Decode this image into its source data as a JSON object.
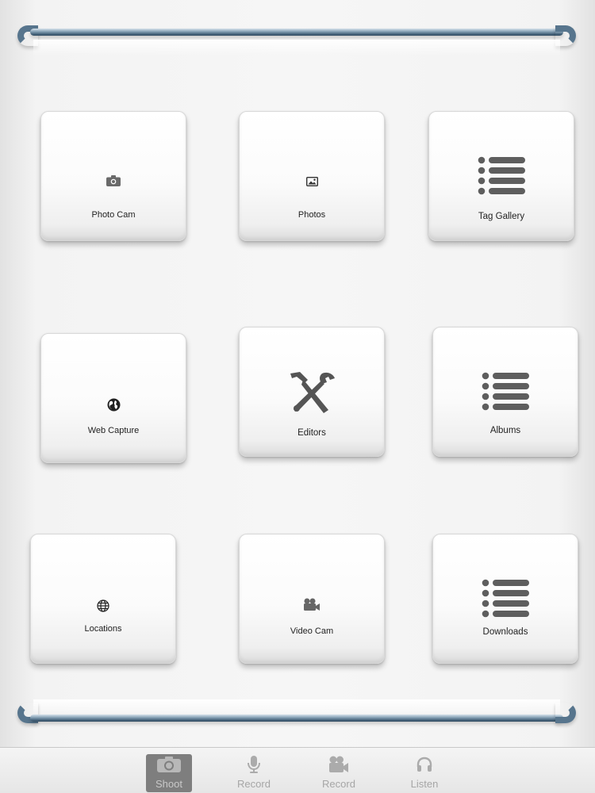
{
  "tiles": [
    {
      "label": "Photo Cam",
      "icon": "camera-icon"
    },
    {
      "label": "Photos",
      "icon": "image-icon"
    },
    {
      "label": "Tag Gallery",
      "icon": "list-icon"
    },
    {
      "label": "Web Capture",
      "icon": "globe-icon"
    },
    {
      "label": "Editors",
      "icon": "tools-icon"
    },
    {
      "label": "Albums",
      "icon": "list-icon"
    },
    {
      "label": "Locations",
      "icon": "globe-grid-icon"
    },
    {
      "label": "Video Cam",
      "icon": "video-camera-icon"
    },
    {
      "label": "Downloads",
      "icon": "list-icon"
    }
  ],
  "tabbar": {
    "items": [
      {
        "label": "Shoot",
        "icon": "camera-icon",
        "active": true
      },
      {
        "label": "Record",
        "icon": "microphone-icon",
        "active": false
      },
      {
        "label": "Record",
        "icon": "video-camera-icon",
        "active": false
      },
      {
        "label": "Listen",
        "icon": "headphones-icon",
        "active": false
      }
    ]
  },
  "colors": {
    "rail": "#4b6880",
    "icon": "#5b5b5b",
    "active_tab": "#7e7e7e"
  }
}
